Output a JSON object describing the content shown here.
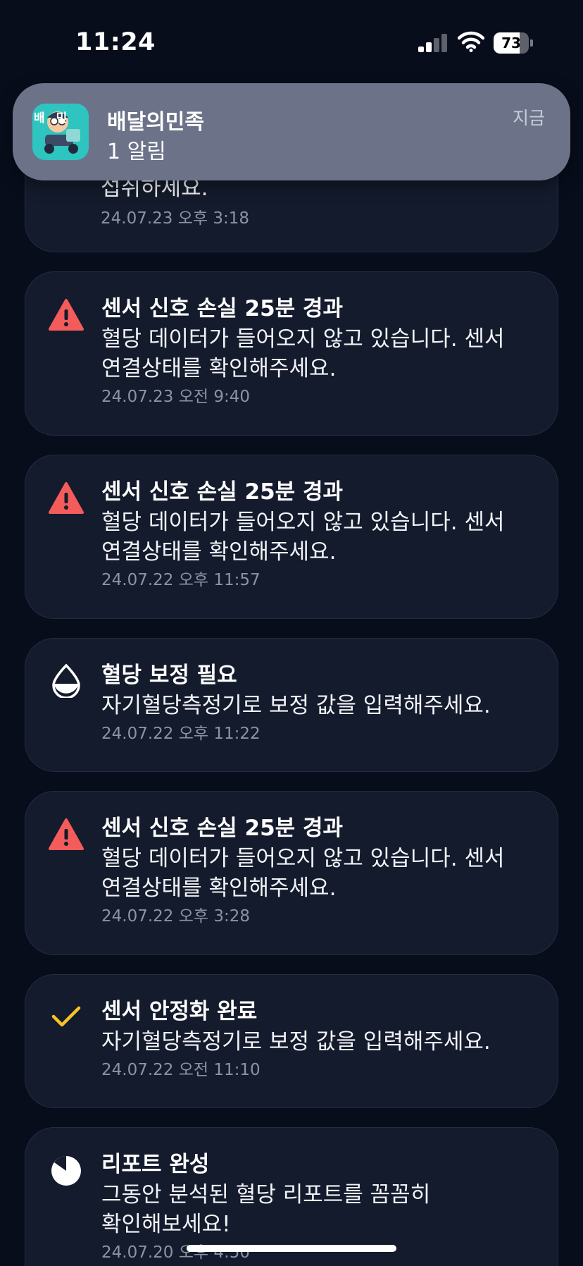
{
  "status_bar": {
    "time": "11:24",
    "battery_level": "73",
    "battery_fraction": 0.73,
    "signal_bars_active": 2,
    "signal_bars_total": 4
  },
  "banner": {
    "app_name": "배달의민족",
    "message": "1 알림",
    "time": "지금",
    "app_icon_text": "배민"
  },
  "partial_card": {
    "body_last_line": "섭취하세요.",
    "date": "24.07.23 오후 3:18"
  },
  "notifications": [
    {
      "icon": "warning-icon",
      "title": "센서 신호 손실 25분 경과",
      "body_lines": [
        "혈당 데이터가 들어오지 않고 있습니다. 센서",
        "연결상태를 확인해주세요."
      ],
      "date": "24.07.23 오전 9:40"
    },
    {
      "icon": "warning-icon",
      "title": "센서 신호 손실 25분 경과",
      "body_lines": [
        "혈당 데이터가 들어오지 않고 있습니다. 센서",
        "연결상태를 확인해주세요."
      ],
      "date": "24.07.22 오후 11:57"
    },
    {
      "icon": "blood-drop-icon",
      "title": "혈당 보정 필요",
      "body_lines": [
        "자기혈당측정기로 보정 값을 입력해주세요."
      ],
      "date": "24.07.22 오후 11:22"
    },
    {
      "icon": "warning-icon",
      "title": "센서 신호 손실 25분 경과",
      "body_lines": [
        "혈당 데이터가 들어오지 않고 있습니다. 센서",
        "연결상태를 확인해주세요."
      ],
      "date": "24.07.22 오후 3:28"
    },
    {
      "icon": "checkmark-icon",
      "title": "센서 안정화 완료",
      "body_lines": [
        "자기혈당측정기로 보정 값을 입력해주세요."
      ],
      "date": "24.07.22 오전 11:10"
    },
    {
      "icon": "report-icon",
      "title": "리포트 완성",
      "body_lines": [
        "그동안 분석된 혈당 리포트를 꼼꼼히",
        "확인해보세요!"
      ],
      "date": "24.07.20 오후 4:50"
    }
  ],
  "colors": {
    "background": "#080d1c",
    "card": "#141b2c",
    "warning": "#f45b5b",
    "check": "#f7c325",
    "banner": "#6c7389"
  }
}
